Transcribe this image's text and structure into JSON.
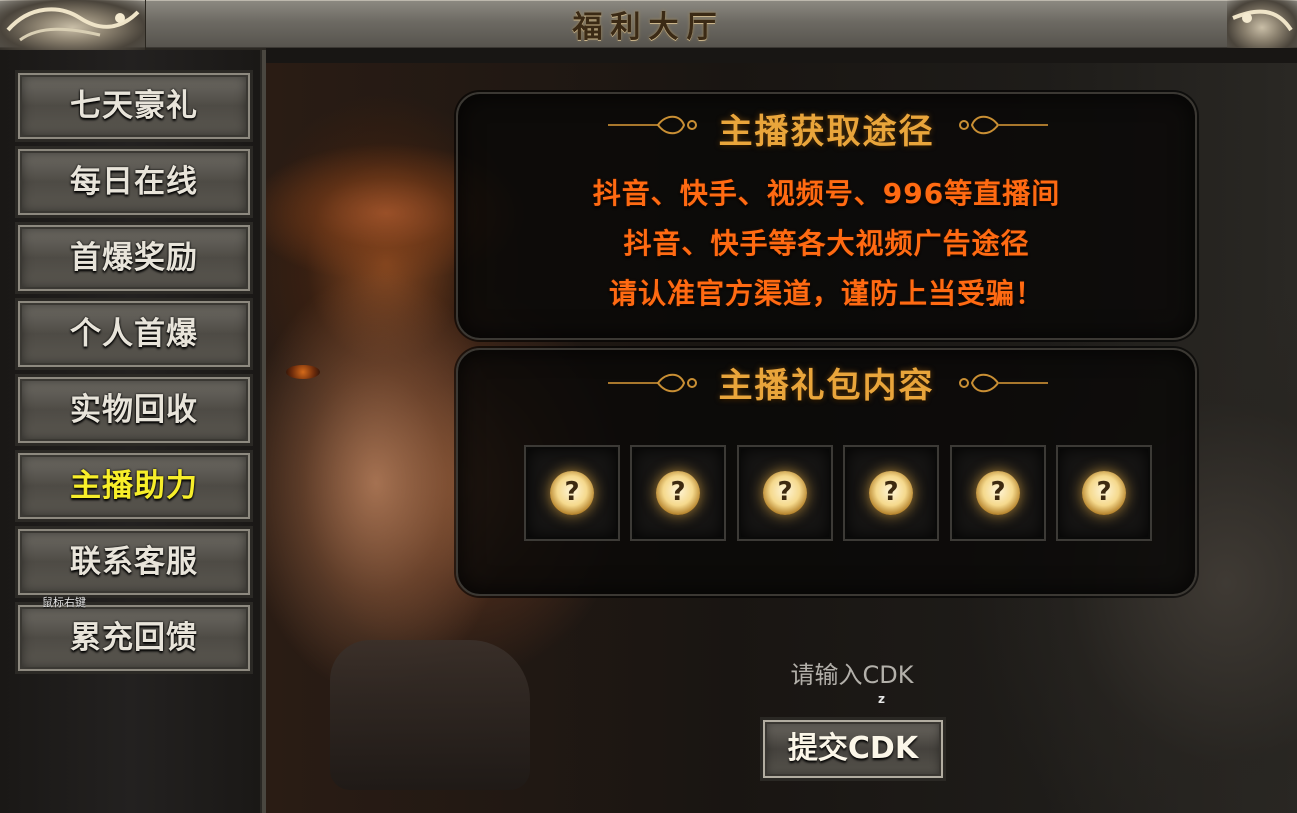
{
  "window": {
    "title": "福利大厅"
  },
  "sidebar": {
    "items": [
      {
        "label": "七天豪礼",
        "active": false
      },
      {
        "label": "每日在线",
        "active": false
      },
      {
        "label": "首爆奖励",
        "active": false
      },
      {
        "label": "个人首爆",
        "active": false
      },
      {
        "label": "实物回收",
        "active": false
      },
      {
        "label": "主播助力",
        "active": true
      },
      {
        "label": "联系客服",
        "active": false
      },
      {
        "label": "累充回馈",
        "active": false
      }
    ],
    "tooltip": "鼠标右键"
  },
  "info_panel": {
    "heading": "主播获取途径",
    "lines": [
      "抖音、快手、视频号、996等直播间",
      "抖音、快手等各大视频广告途径",
      "请认准官方渠道，谨防上当受骗！"
    ]
  },
  "gift_panel": {
    "heading": "主播礼包内容",
    "slots": [
      {
        "icon": "question-mark-icon",
        "symbol": "?"
      },
      {
        "icon": "question-mark-icon",
        "symbol": "?"
      },
      {
        "icon": "question-mark-icon",
        "symbol": "?"
      },
      {
        "icon": "question-mark-icon",
        "symbol": "?"
      },
      {
        "icon": "question-mark-icon",
        "symbol": "?"
      },
      {
        "icon": "question-mark-icon",
        "symbol": "?"
      }
    ]
  },
  "cdk": {
    "placeholder": "请输入CDK",
    "hint": "z",
    "submit_label": "提交CDK"
  },
  "colors": {
    "active_menu": "#f7ee2a",
    "heading_gold": "#e9a53b",
    "info_orange": "#ff6a12",
    "menu_text": "#e8e4da"
  }
}
